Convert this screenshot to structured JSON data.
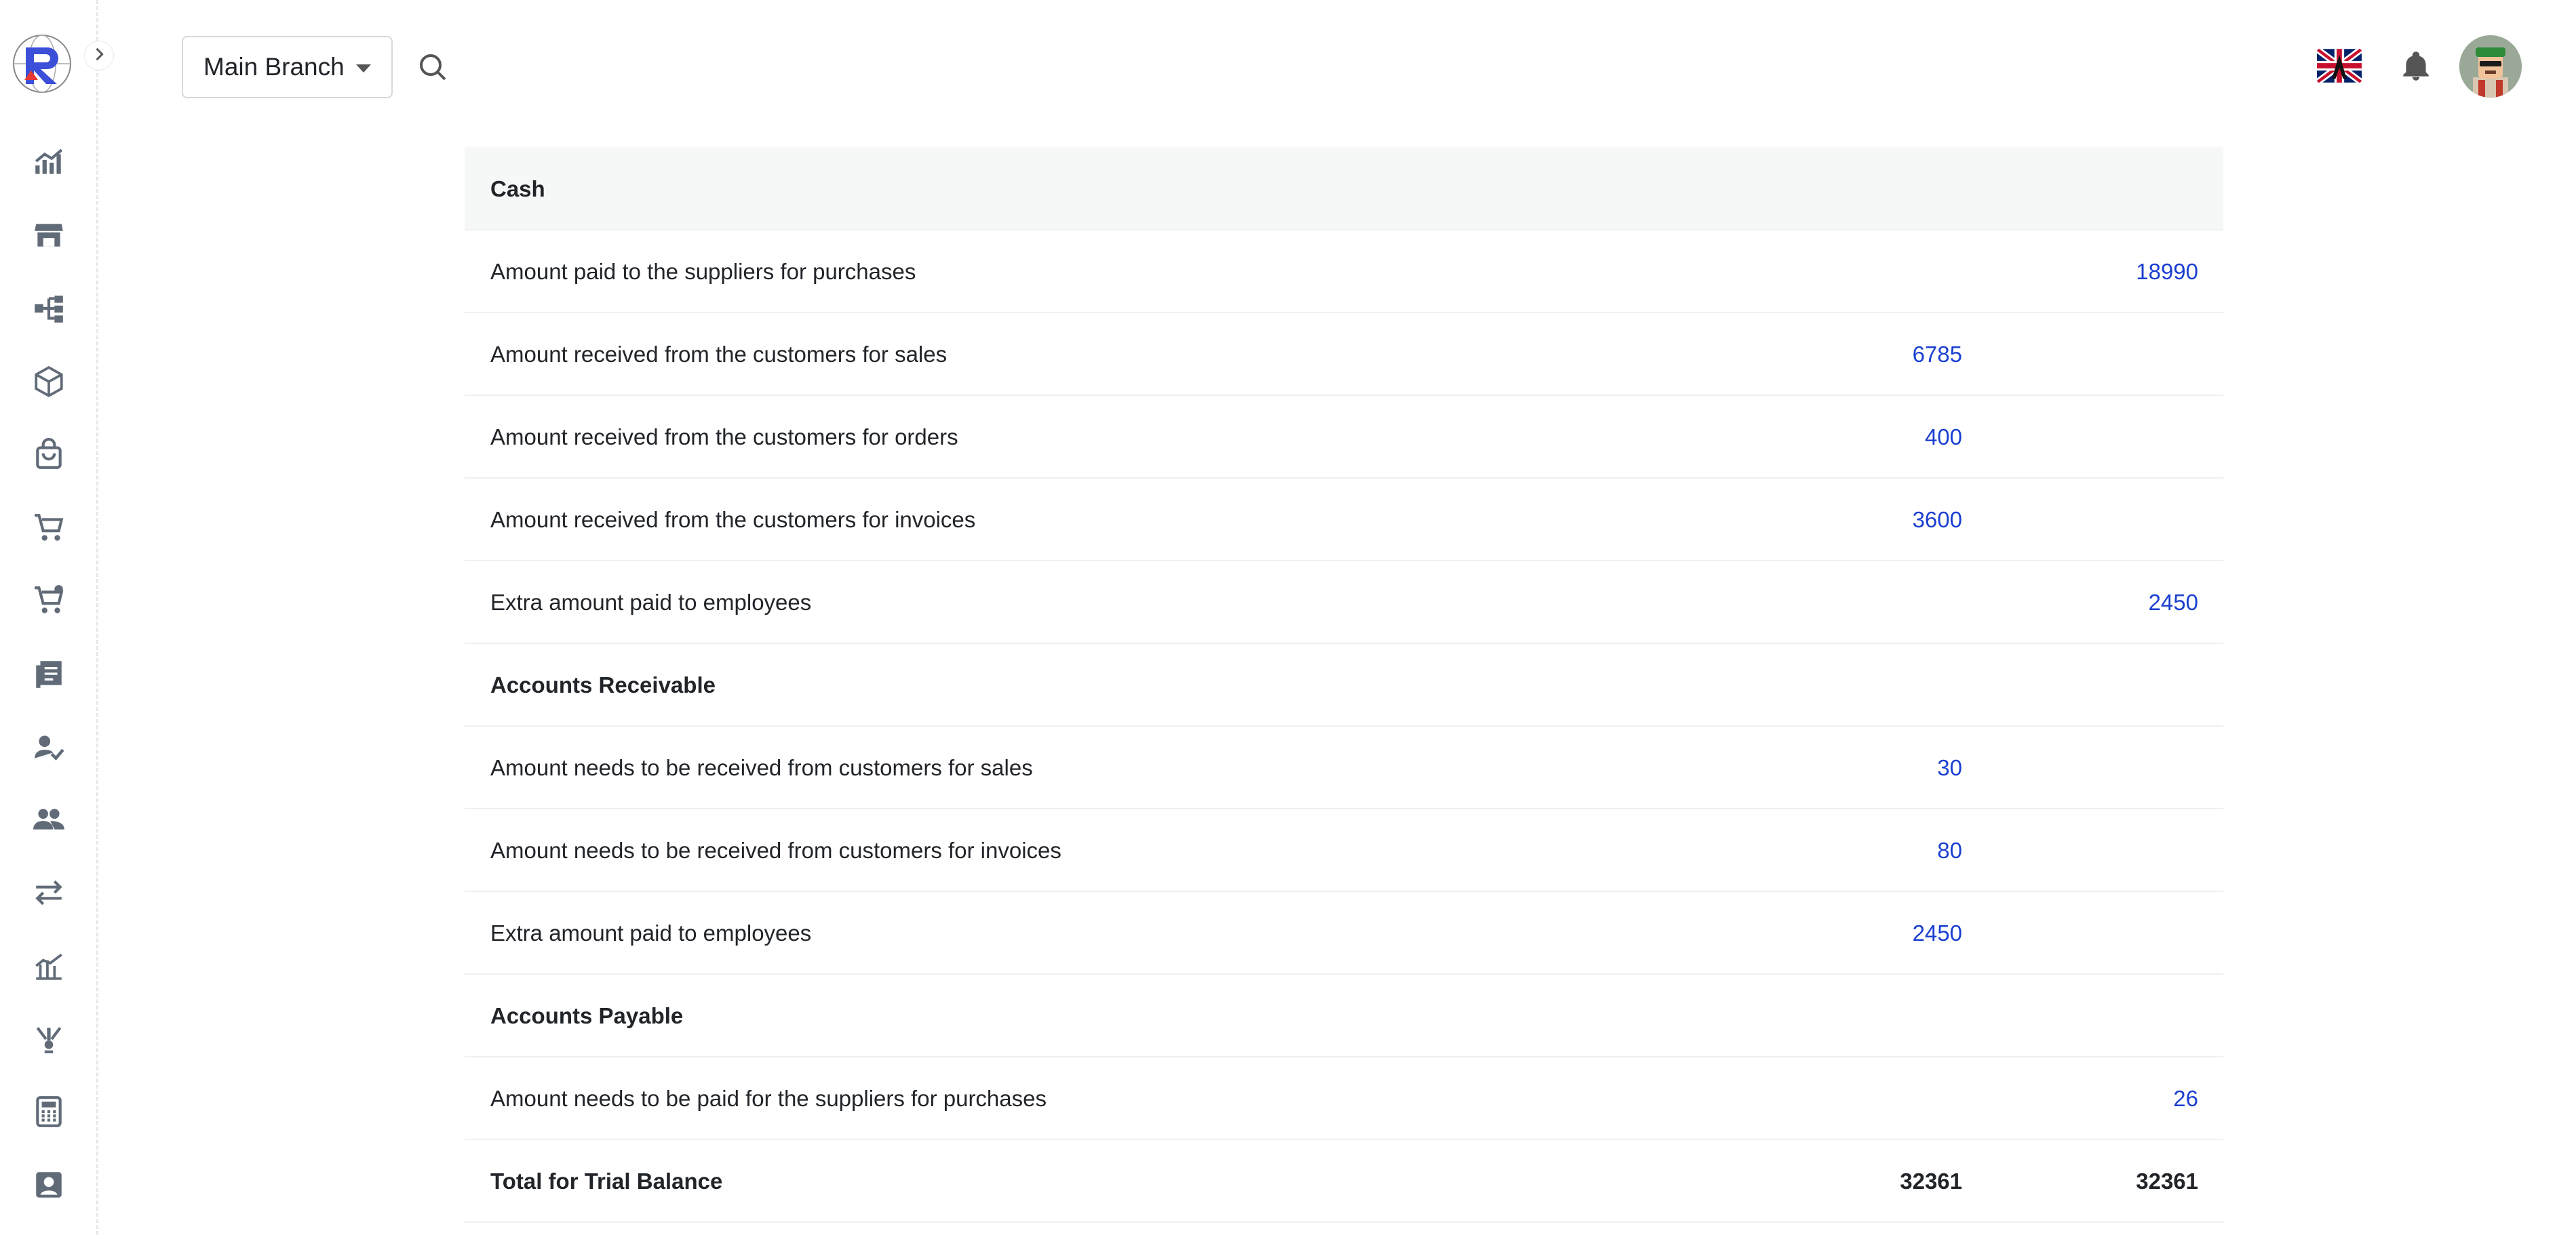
{
  "header": {
    "branch_label": "Main Branch"
  },
  "icons": {
    "sidebar": [
      "chart-line-icon",
      "store-icon",
      "hierarchy-icon",
      "box-icon",
      "shopping-bag-icon",
      "cart-icon",
      "cart-plus-icon",
      "receipt-icon",
      "user-check-icon",
      "users-icon",
      "transfer-icon",
      "chart-growth-icon",
      "warehouse-icon",
      "calculator-icon",
      "contact-icon"
    ]
  },
  "colors": {
    "amount": "#1a3fd0",
    "section_bg": "#f6f7f7"
  },
  "faded_rows": [
    {
      "label": "",
      "credit": ""
    },
    {
      "label": "",
      "credit": ""
    }
  ],
  "rows": [
    {
      "type": "section",
      "label": "Cash",
      "debit": "",
      "credit": ""
    },
    {
      "type": "item",
      "label": "Amount paid to the suppliers for purchases",
      "debit": "",
      "credit": "18990"
    },
    {
      "type": "item",
      "label": "Amount received from the customers for sales",
      "debit": "6785",
      "credit": ""
    },
    {
      "type": "item",
      "label": "Amount received from the customers for orders",
      "debit": "400",
      "credit": ""
    },
    {
      "type": "item",
      "label": "Amount received from the customers for invoices",
      "debit": "3600",
      "credit": ""
    },
    {
      "type": "item",
      "label": "Extra amount paid to employees",
      "debit": "",
      "credit": "2450"
    },
    {
      "type": "heading",
      "label": "Accounts Receivable",
      "debit": "",
      "credit": ""
    },
    {
      "type": "item",
      "label": "Amount needs to be received from customers for sales",
      "debit": "30",
      "credit": ""
    },
    {
      "type": "item",
      "label": "Amount needs to be received from customers for invoices",
      "debit": "80",
      "credit": ""
    },
    {
      "type": "item",
      "label": "Extra amount paid to employees",
      "debit": "2450",
      "credit": ""
    },
    {
      "type": "heading",
      "label": "Accounts Payable",
      "debit": "",
      "credit": ""
    },
    {
      "type": "item",
      "label": "Amount needs to be paid for the suppliers for purchases",
      "debit": "",
      "credit": "26"
    },
    {
      "type": "total",
      "label": "Total for Trial Balance",
      "debit": "32361",
      "credit": "32361"
    }
  ]
}
